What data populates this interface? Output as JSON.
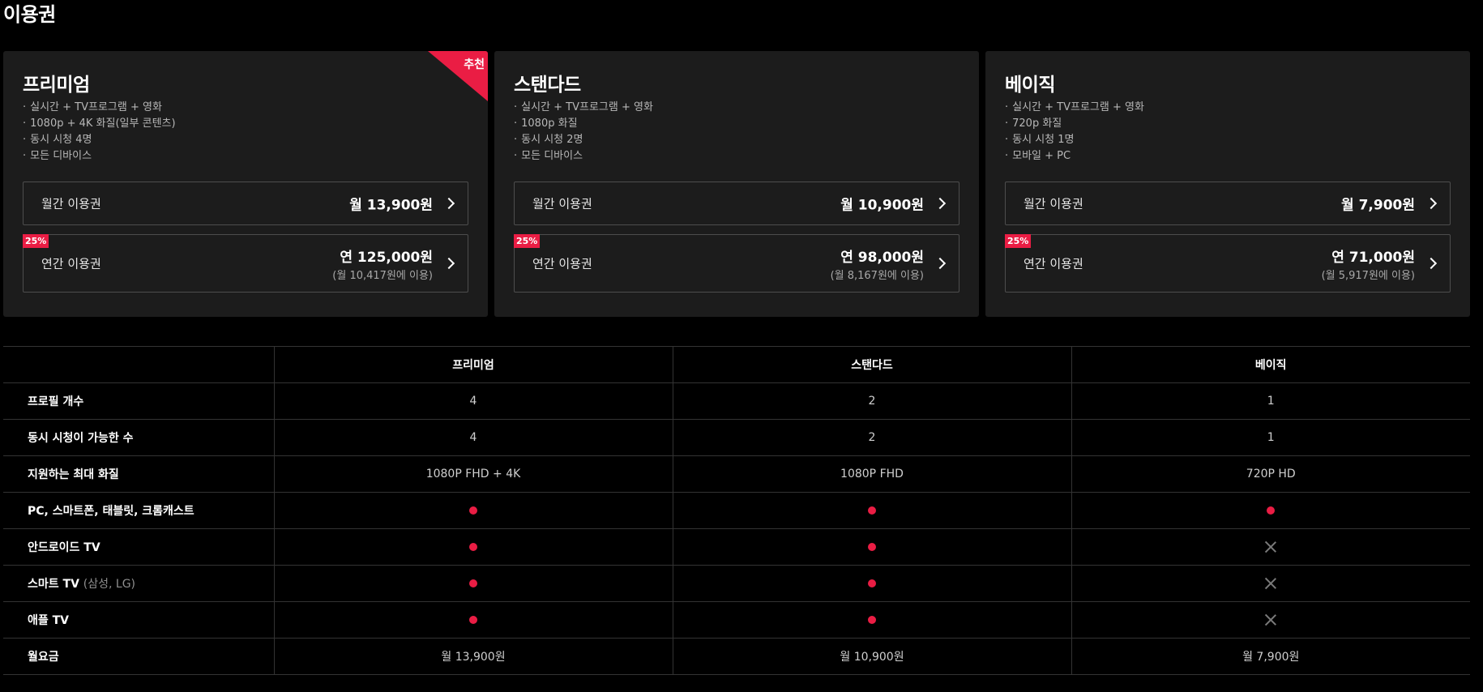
{
  "page": {
    "title": "이용권"
  },
  "plans": [
    {
      "name": "프리미엄",
      "recommended": "추천",
      "features": [
        "실시간 + TV프로그램 + 영화",
        "1080p + 4K 화질(일부 콘텐츠)",
        "동시 시청 4명",
        "모든 디바이스"
      ],
      "monthly": {
        "label": "월간 이용권",
        "price": "월 13,900원"
      },
      "yearly": {
        "badge": "25%",
        "label": "연간 이용권",
        "price": "연 125,000원",
        "sub": "(월 10,417원에 이용)"
      }
    },
    {
      "name": "스탠다드",
      "recommended": "",
      "features": [
        "실시간 + TV프로그램 + 영화",
        "1080p 화질",
        "동시 시청 2명",
        "모든 디바이스"
      ],
      "monthly": {
        "label": "월간 이용권",
        "price": "월 10,900원"
      },
      "yearly": {
        "badge": "25%",
        "label": "연간 이용권",
        "price": "연 98,000원",
        "sub": "(월 8,167원에 이용)"
      }
    },
    {
      "name": "베이직",
      "recommended": "",
      "features": [
        "실시간 + TV프로그램 + 영화",
        "720p 화질",
        "동시 시청 1명",
        "모바일 + PC"
      ],
      "monthly": {
        "label": "월간 이용권",
        "price": "월 7,900원"
      },
      "yearly": {
        "badge": "25%",
        "label": "연간 이용권",
        "price": "연 71,000원",
        "sub": "(월 5,917원에 이용)"
      }
    }
  ],
  "comparison": {
    "headers": [
      "",
      "프리미엄",
      "스탠다드",
      "베이직"
    ],
    "rows": [
      {
        "label": "프로필 개수",
        "note": "",
        "cells": [
          "4",
          "2",
          "1"
        ]
      },
      {
        "label": "동시 시청이 가능한 수",
        "note": "",
        "cells": [
          "4",
          "2",
          "1"
        ]
      },
      {
        "label": "지원하는 최대 화질",
        "note": "",
        "cells": [
          "1080P FHD + 4K",
          "1080P FHD",
          "720P HD"
        ]
      },
      {
        "label": "PC, 스마트폰, 태블릿, 크롬캐스트",
        "note": "",
        "cells": [
          "dot",
          "dot",
          "dot"
        ]
      },
      {
        "label": "안드로이드 TV",
        "note": "",
        "cells": [
          "dot",
          "dot",
          "x"
        ]
      },
      {
        "label": "스마트 TV",
        "note": "(삼성, LG)",
        "cells": [
          "dot",
          "dot",
          "x"
        ]
      },
      {
        "label": "애플 TV",
        "note": "",
        "cells": [
          "dot",
          "dot",
          "x"
        ]
      },
      {
        "label": "월요금",
        "note": "",
        "cells": [
          "월 13,900원",
          "월 10,900원",
          "월 7,900원"
        ]
      }
    ],
    "icons": {
      "dot": "supported-dot-icon",
      "x": "unsupported-x-icon"
    },
    "accent_color": "#ea1d44"
  }
}
